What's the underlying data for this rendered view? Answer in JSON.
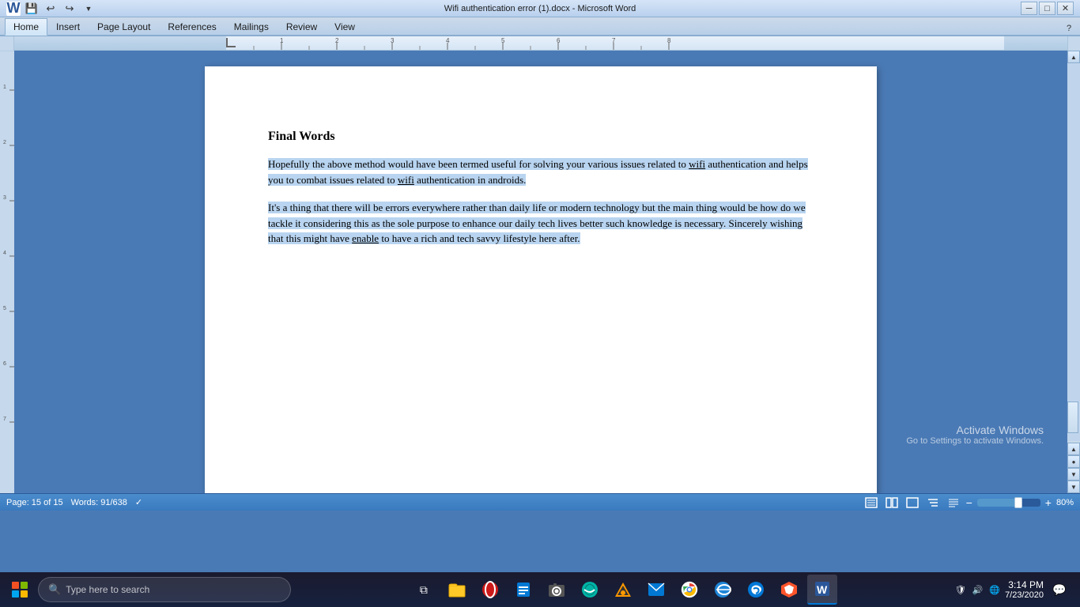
{
  "window": {
    "title": "Wifi authentication error (1).docx - Microsoft Word",
    "minimize_label": "─",
    "restore_label": "□",
    "close_label": "✕"
  },
  "quick_access": {
    "save_label": "💾",
    "undo_label": "↩",
    "redo_label": "↪"
  },
  "ribbon": {
    "tabs": [
      {
        "label": "Home",
        "active": true
      },
      {
        "label": "Insert",
        "active": false
      },
      {
        "label": "Page Layout",
        "active": false
      },
      {
        "label": "References",
        "active": false
      },
      {
        "label": "Mailings",
        "active": false
      },
      {
        "label": "Review",
        "active": false
      },
      {
        "label": "View",
        "active": false
      }
    ]
  },
  "document": {
    "section_title": "Final Words",
    "paragraph1": "Hopefully the above method would have been termed useful for solving your various issues related to wifi authentication and helps you to combat issues related to wifi authentication in androids.",
    "paragraph2": "It's a thing that there will be errors everywhere rather than daily life or modern technology but the main thing would be how do we tackle it considering this as the sole purpose to enhance our daily tech lives better such knowledge is necessary. Sincerely wishing that this might have enable to have a rich and tech savvy lifestyle here after."
  },
  "status_bar": {
    "page_info": "Page: 15 of 15",
    "words_info": "Words: 91/638",
    "zoom_level": "80%"
  },
  "activate_windows": {
    "title": "Activate Windows",
    "subtitle": "Go to Settings to activate Windows."
  },
  "taskbar": {
    "search_placeholder": "Type here to search",
    "clock_time": "3:14 PM",
    "clock_date": "7/23/2020",
    "icons": [
      {
        "name": "task-view",
        "symbol": "⧉"
      },
      {
        "name": "file-explorer",
        "symbol": "📁"
      },
      {
        "name": "opera",
        "symbol": "O"
      },
      {
        "name": "files",
        "symbol": "🗂"
      },
      {
        "name": "camera",
        "symbol": "📷"
      },
      {
        "name": "edge-chromium",
        "symbol": "🌐"
      },
      {
        "name": "vlc",
        "symbol": "🔶"
      },
      {
        "name": "mail",
        "symbol": "✉"
      },
      {
        "name": "chrome",
        "symbol": "●"
      },
      {
        "name": "ie",
        "symbol": "e"
      },
      {
        "name": "edge",
        "symbol": "e"
      },
      {
        "name": "brave",
        "symbol": "🦁"
      },
      {
        "name": "word",
        "symbol": "W"
      }
    ]
  }
}
